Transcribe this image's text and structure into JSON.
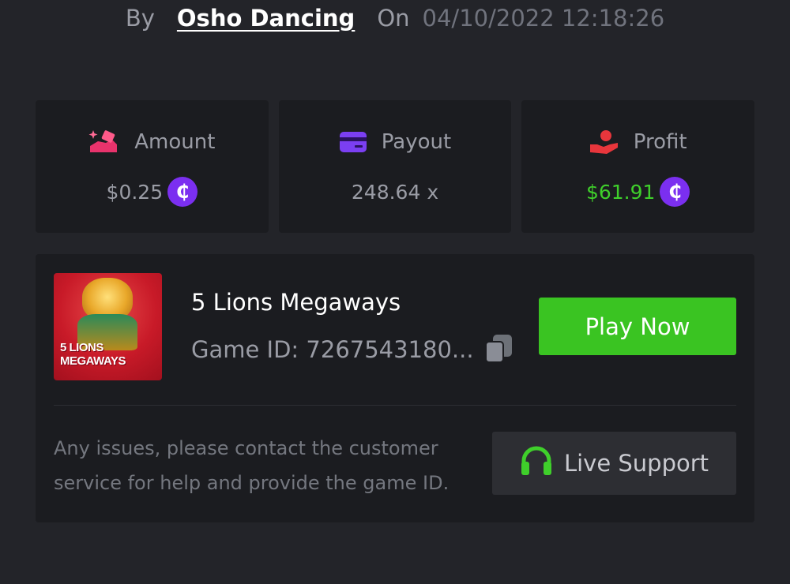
{
  "bet_meta": {
    "by_label": "By",
    "user_name": "Osho Dancing",
    "on_label": "On",
    "datetime": "04/10/2022 12:18:26"
  },
  "stats": {
    "amount": {
      "label": "Amount",
      "value": "$0.25",
      "icon": "bet-hand-icon",
      "icon_color": "#e8336c"
    },
    "payout": {
      "label": "Payout",
      "value": "248.64 x",
      "icon": "card-icon",
      "icon_color": "#7b3ff2"
    },
    "profit": {
      "label": "Profit",
      "value": "$61.91",
      "icon": "coin-hand-icon",
      "icon_color": "#e8363c",
      "value_color": "#3fcf2b"
    },
    "currency_symbol": "₵",
    "currency_color": "#7b2ff0"
  },
  "game": {
    "title": "5 Lions Megaways",
    "game_id_label": "Game ID: 7267543180...",
    "thumbnail_text": "5 LIONS MEGAWAYS",
    "play_button": "Play Now",
    "play_color": "#3ac422"
  },
  "support": {
    "help_text": "Any issues, please contact the customer service for help and provide the game ID.",
    "button_label": "Live Support",
    "icon": "headset-icon",
    "icon_color": "#3fcf2b"
  }
}
